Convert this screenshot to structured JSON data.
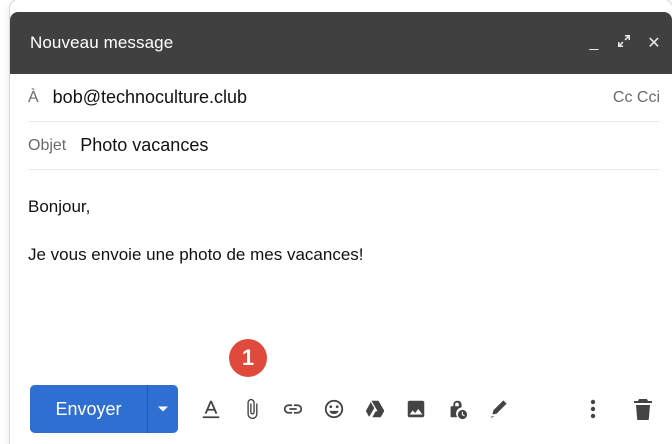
{
  "header": {
    "title": "Nouveau message",
    "minimize_icon": "minimize-icon",
    "expand_icon": "expand-icon",
    "close_icon": "close-icon"
  },
  "to": {
    "label": "À",
    "value": "bob@technoculture.club",
    "cc_links": "Cc Cci"
  },
  "subject": {
    "label": "Objet",
    "value": "Photo vacances"
  },
  "body": {
    "line1": "Bonjour,",
    "line2": "Je vous envoie une photo de mes vacances!"
  },
  "annotation": {
    "badge": "1"
  },
  "toolbar": {
    "send_label": "Envoyer",
    "icons": [
      "format-text-icon",
      "attach-icon",
      "link-icon",
      "emoji-icon",
      "drive-icon",
      "photo-icon",
      "confidential-icon",
      "signature-icon",
      "more-icon",
      "trash-icon"
    ]
  },
  "colors": {
    "header_bg": "#404040",
    "send_bg": "#2f6fd1",
    "badge_bg": "#e04a3c"
  }
}
